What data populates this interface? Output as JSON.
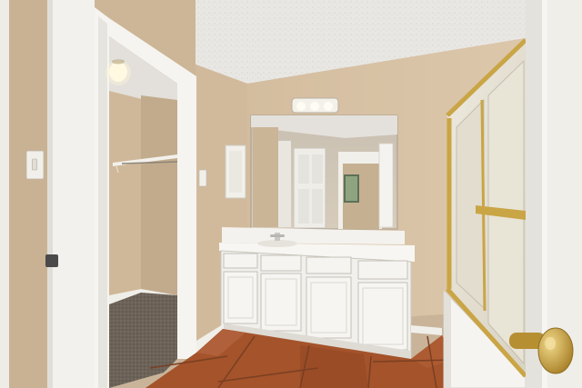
{
  "scene": {
    "colors": {
      "ceiling": "#e8e6e2",
      "wall": "#d9c4a8",
      "wall_shadow": "#c8b194",
      "trim": "#f3f1ec",
      "floor_tile": "#a4532a",
      "grout": "#7a3f22",
      "carpet": "#6d6358",
      "brass": "#c9a545",
      "glass": "#e6e2d4",
      "mirror": "#cfc6b8"
    },
    "icons": [
      "light-fixture-icon",
      "door-knob-icon",
      "light-switch-icon",
      "faucet-icon"
    ]
  }
}
